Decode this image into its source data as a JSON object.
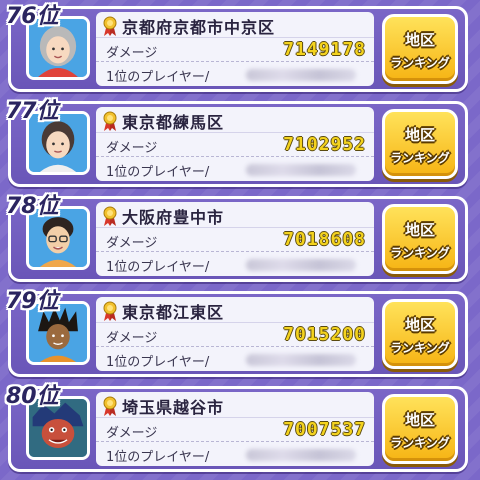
{
  "rankings": [
    {
      "rank": "76位",
      "location": "京都府京都市中京区",
      "damage_label": "ダメージ",
      "damage": "7149178",
      "player_label": "1位のプレイヤー/",
      "button_line1": "地区",
      "button_line2": "ランキング",
      "avatar_icon": "elderly-woman-avatar-icon"
    },
    {
      "rank": "77位",
      "location": "東京都練馬区",
      "damage_label": "ダメージ",
      "damage": "7102952",
      "player_label": "1位のプレイヤー/",
      "button_line1": "地区",
      "button_line2": "ランキング",
      "avatar_icon": "woman-avatar-icon"
    },
    {
      "rank": "78位",
      "location": "大阪府豊中市",
      "damage_label": "ダメージ",
      "damage": "7018608",
      "player_label": "1位のプレイヤー/",
      "button_line1": "地区",
      "button_line2": "ランキング",
      "avatar_icon": "glasses-man-avatar-icon"
    },
    {
      "rank": "79位",
      "location": "東京都江東区",
      "damage_label": "ダメージ",
      "damage": "7015200",
      "player_label": "1位のプレイヤー/",
      "button_line1": "地区",
      "button_line2": "ランキング",
      "avatar_icon": "spiky-hair-avatar-icon"
    },
    {
      "rank": "80位",
      "location": "埼玉県越谷市",
      "damage_label": "ダメージ",
      "damage": "7007537",
      "player_label": "1位のプレイヤー/",
      "button_line1": "地区",
      "button_line2": "ランキング",
      "avatar_icon": "monster-avatar-icon"
    }
  ],
  "colors": {
    "background": "#7b68c9",
    "card": "#6a56b8",
    "button": "#f6b414",
    "damage_value": "#f4d31e",
    "medal": "#d8372a"
  }
}
